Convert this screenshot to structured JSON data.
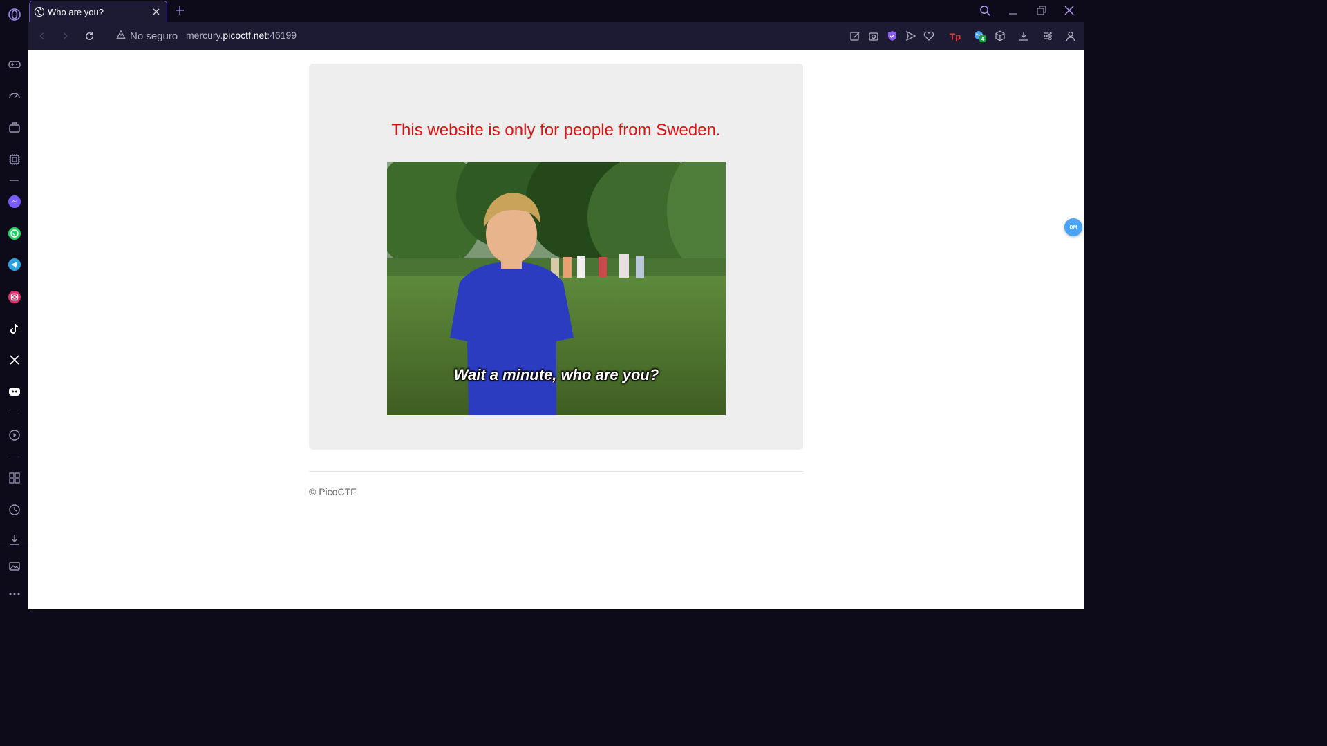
{
  "browser": {
    "tab_title": "Who are you?",
    "security_label": "No seguro",
    "url_prefix": "mercury.",
    "url_domain": "picoctf.net",
    "url_suffix": ":46199",
    "extension_badge_count": "4",
    "accent_color": "#6a4fd6"
  },
  "sidebar": {
    "items": [
      "gamepad-icon",
      "speed-dial-icon",
      "briefcase-icon",
      "chip-icon",
      "messenger-icon",
      "whatsapp-icon",
      "telegram-icon",
      "instagram-icon",
      "tiktok-icon",
      "x-icon",
      "discord-icon",
      "player-icon",
      "apps-icon",
      "history-icon",
      "downloads-icon",
      "gallery-icon",
      "more-icon"
    ]
  },
  "page": {
    "headline": "This website is only for people from Sweden.",
    "headline_color": "#e01010",
    "image_caption": "Wait a minute, who are you?",
    "footer": "© PicoCTF",
    "floating_badge": "DM"
  }
}
